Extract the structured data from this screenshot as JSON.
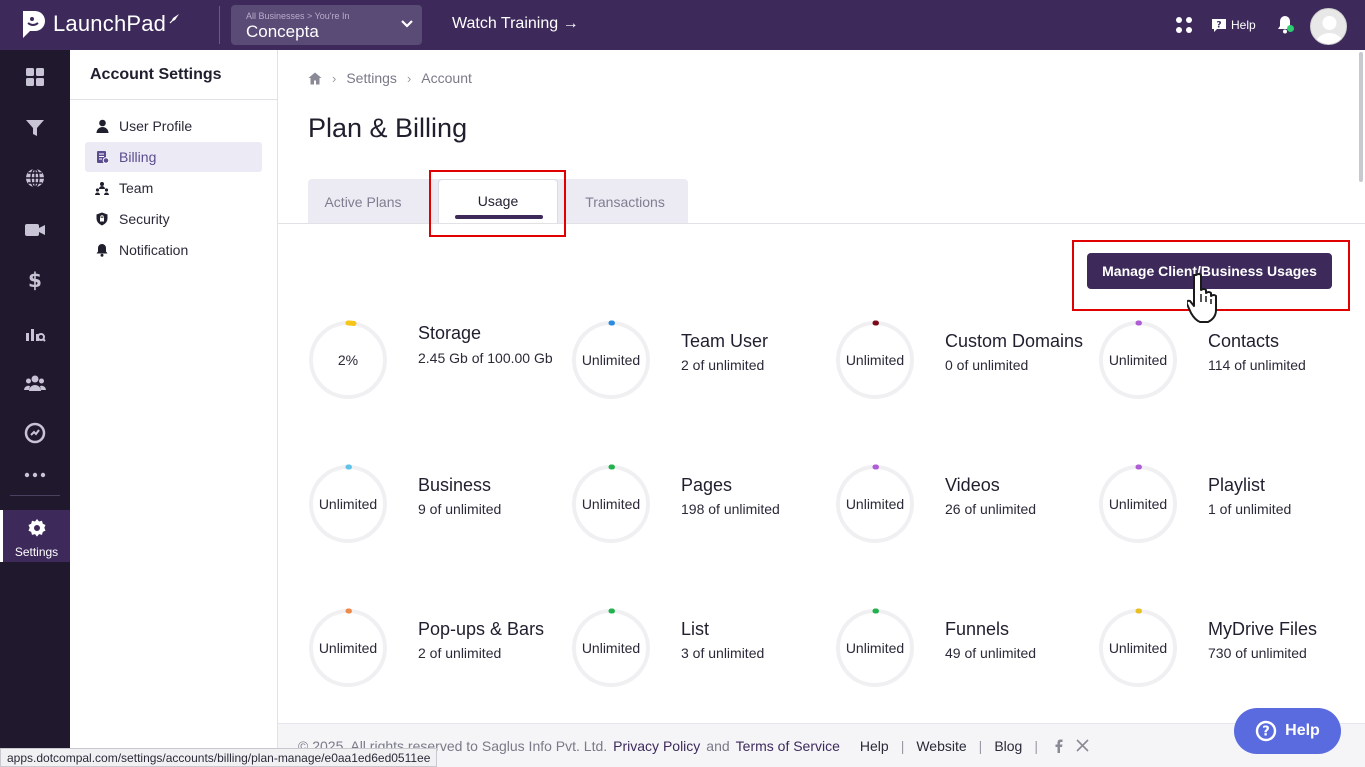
{
  "topbar": {
    "logo_text": "LaunchPad",
    "business_select": {
      "crumb": "All Businesses > You're In",
      "name": "Concepta"
    },
    "watch_training": "Watch Training →",
    "help_label": "Help",
    "brand_color": "#3d2a5b"
  },
  "rail": {
    "items": [
      "dashboard-icon",
      "funnel-icon",
      "globe-icon",
      "video-icon",
      "dollar-icon",
      "analytics-icon",
      "users-icon",
      "gauge-icon",
      "more-icon"
    ],
    "settings_label": "Settings"
  },
  "sidebar": {
    "title": "Account Settings",
    "items": [
      {
        "label": "User Profile",
        "icon": "user-icon",
        "active": false
      },
      {
        "label": "Billing",
        "icon": "billing-icon",
        "active": true
      },
      {
        "label": "Team",
        "icon": "team-icon",
        "active": false
      },
      {
        "label": "Security",
        "icon": "shield-icon",
        "active": false
      },
      {
        "label": "Notification",
        "icon": "bell-icon",
        "active": false
      }
    ]
  },
  "breadcrumb": {
    "settings": "Settings",
    "account": "Account"
  },
  "page_title": "Plan & Billing",
  "tabs": [
    {
      "label": "Active Plans",
      "active": false
    },
    {
      "label": "Usage",
      "active": true
    },
    {
      "label": "Transactions",
      "active": false
    }
  ],
  "manage_button": "Manage Client/Business Usages",
  "usage": [
    {
      "title": "Storage",
      "sub": "2.45 Gb of 100.00 Gb",
      "ring_label": "2%",
      "percent": 2,
      "color": "#f5c518"
    },
    {
      "title": "Team User",
      "sub": "2 of unlimited",
      "ring_label": "Unlimited",
      "percent": 0,
      "color": "#2a8be0"
    },
    {
      "title": "Custom Domains",
      "sub": "0 of unlimited",
      "ring_label": "Unlimited",
      "percent": 0,
      "color": "#7a0a1a"
    },
    {
      "title": "Contacts",
      "sub": "114 of unlimited",
      "ring_label": "Unlimited",
      "percent": 0,
      "color": "#b05cd6"
    },
    {
      "title": "Business",
      "sub": "9 of unlimited",
      "ring_label": "Unlimited",
      "percent": 0,
      "color": "#5fc4e8"
    },
    {
      "title": "Pages",
      "sub": "198 of unlimited",
      "ring_label": "Unlimited",
      "percent": 0,
      "color": "#22b14c"
    },
    {
      "title": "Videos",
      "sub": "26 of unlimited",
      "ring_label": "Unlimited",
      "percent": 0,
      "color": "#b05cd6"
    },
    {
      "title": "Playlist",
      "sub": "1 of unlimited",
      "ring_label": "Unlimited",
      "percent": 0,
      "color": "#b05cd6"
    },
    {
      "title": "Pop-ups & Bars",
      "sub": "2 of unlimited",
      "ring_label": "Unlimited",
      "percent": 0,
      "color": "#f08a4b"
    },
    {
      "title": "List",
      "sub": "3 of unlimited",
      "ring_label": "Unlimited",
      "percent": 0,
      "color": "#22b14c"
    },
    {
      "title": "Funnels",
      "sub": "49 of unlimited",
      "ring_label": "Unlimited",
      "percent": 0,
      "color": "#22b14c"
    },
    {
      "title": "MyDrive Files",
      "sub": "730 of unlimited",
      "ring_label": "Unlimited",
      "percent": 0,
      "color": "#e8c020"
    }
  ],
  "footer": {
    "copyright": "© 2025. All rights reserved to Saglus Info Pvt. Ltd.",
    "privacy": "Privacy Policy",
    "and": "and",
    "terms": "Terms of Service",
    "help": "Help",
    "website": "Website",
    "blog": "Blog",
    "sep": "|"
  },
  "help_fab": "Help",
  "status_url": "apps.dotcompal.com/settings/accounts/billing/plan-manage/e0aa1ed6ed0511ee"
}
